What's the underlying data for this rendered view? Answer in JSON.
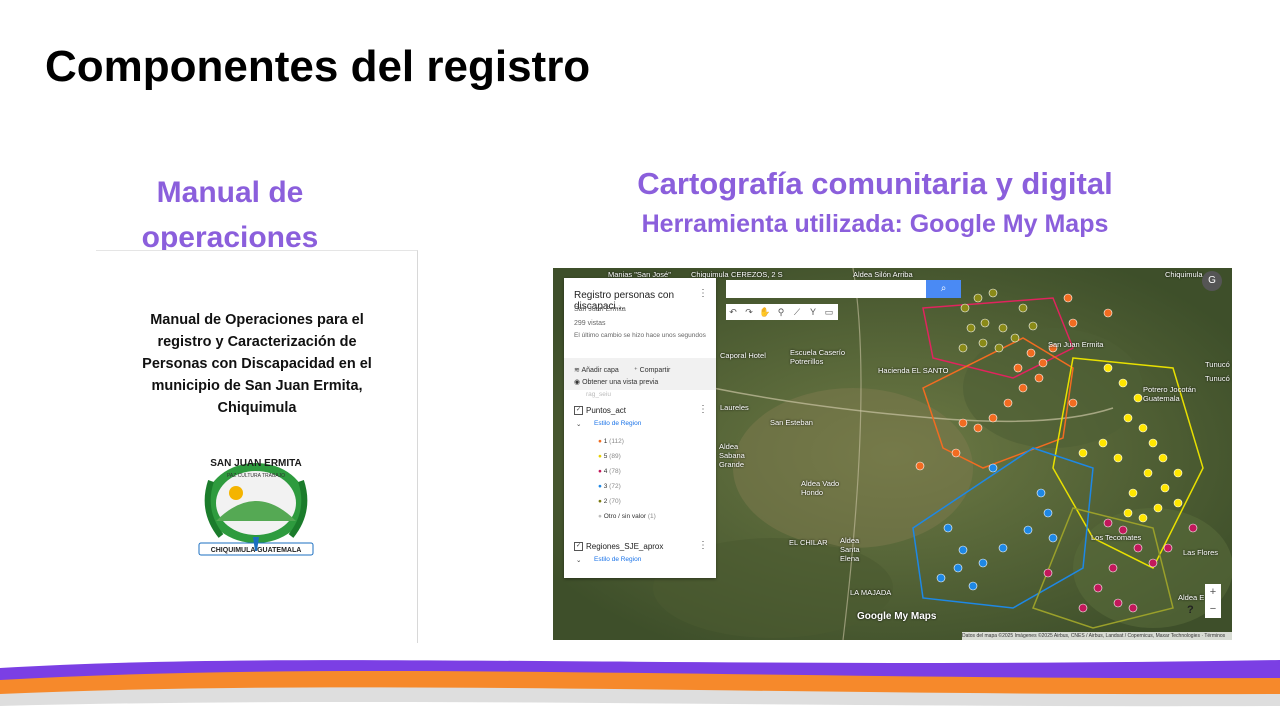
{
  "slide": {
    "title": "Componentes del registro",
    "left_heading": "Manual de operaciones",
    "right_heading": "Cartografía comunitaria y digital",
    "right_subheading": "Herramienta utilizada: Google My Maps"
  },
  "manual": {
    "text": "Manual de Operaciones para el registro y Caracterización de Personas con Discapacidad en el municipio de San Juan Ermita, Chiquimula",
    "logo": {
      "top_text": "SAN JUAN ERMITA",
      "motto": "PAZ  CULTURA TRABAJO",
      "bottom_text": "CHIQUIMULA  GUATEMALA"
    }
  },
  "map": {
    "panel": {
      "title": "Registro personas con discapaci...",
      "subtitle": "San Juan Ermita",
      "views": "299 vistas",
      "last_change": "El último cambio se hizo hace unos segundos",
      "add_layer": "Añadir capa",
      "share": "Compartir",
      "preview": "Obtener una vista previa",
      "hidden_layer": "rag_seiu",
      "layers": [
        {
          "name": "Puntos_act",
          "style": "Estilo de Region",
          "legend": [
            {
              "label": "1",
              "count": "(112)",
              "color": "#f26c21"
            },
            {
              "label": "5",
              "count": "(89)",
              "color": "#ffe600"
            },
            {
              "label": "4",
              "count": "(78)",
              "color": "#c2185b"
            },
            {
              "label": "3",
              "count": "(72)",
              "color": "#1e88e5"
            },
            {
              "label": "2",
              "count": "(70)",
              "color": "#7a7a12"
            },
            {
              "label": "Otro / sin valor",
              "count": "(1)",
              "color": "#bdbdbd"
            }
          ]
        },
        {
          "name": "Regiones_SJE_aprox",
          "style": "Estilo de Region"
        }
      ]
    },
    "search_icon": "search-icon",
    "places": [
      {
        "name": "Manias \"San José\"",
        "cls": "p1"
      },
      {
        "name": "Chiquimula",
        "cls": "p2"
      },
      {
        "name": "CEREZOS, 2 S",
        "cls": "p3"
      },
      {
        "name": "Aldea Silón Arriba",
        "cls": "p4"
      },
      {
        "name": "Chiquimula",
        "cls": "p5"
      },
      {
        "name": "Caporal Hotel",
        "cls": "p6"
      },
      {
        "name": "Escuela Caserío Potrerillos",
        "cls": "p7"
      },
      {
        "name": "Hacienda EL SANTO",
        "cls": "p8"
      },
      {
        "name": "San Juan Ermita",
        "cls": "p9"
      },
      {
        "name": "Potrero Jocotán Guatemala",
        "cls": "p10"
      },
      {
        "name": "Tunucó",
        "cls": "p11"
      },
      {
        "name": "Laureles",
        "cls": "p12"
      },
      {
        "name": "San Esteban",
        "cls": "p13"
      },
      {
        "name": "Aldea Sabana Grande",
        "cls": "p14"
      },
      {
        "name": "Aldea Vado Hondo",
        "cls": "p15"
      },
      {
        "name": "EL CHILAR",
        "cls": "p16"
      },
      {
        "name": "Aldea Santa Elena",
        "cls": "p17"
      },
      {
        "name": "LA MAJADA",
        "cls": "p18"
      },
      {
        "name": "Los Tecomates",
        "cls": "p19"
      },
      {
        "name": "Las Flores",
        "cls": "p20"
      },
      {
        "name": "Aldea E",
        "cls": "p21"
      },
      {
        "name": "Tunucó",
        "cls": "p22"
      }
    ],
    "watermark": "Google My Maps",
    "attribution": "Datos del mapa ©2025 Imágenes ©2025 Airbus, CNES / Airbus, Landsat / Copernicus, Maxar Technologies · Términos",
    "avatar": "G",
    "zoom_in": "+",
    "zoom_out": "−",
    "help": "?"
  },
  "colors": {
    "accent": "#8b5fdc",
    "orange": "#f26c21",
    "yellow": "#ffe600",
    "magenta": "#c2185b",
    "blue": "#1e88e5",
    "olive": "#7a7a12"
  }
}
